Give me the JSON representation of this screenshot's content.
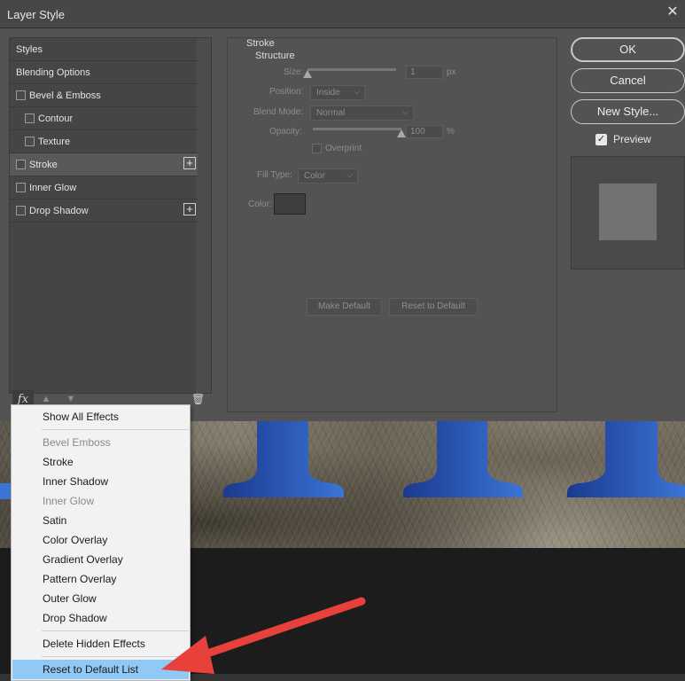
{
  "window": {
    "title": "Layer Style",
    "close_glyph": "✕"
  },
  "styles_list": [
    {
      "label": "Styles",
      "checkbox": false,
      "plus": false,
      "indent": 0,
      "selected": false
    },
    {
      "label": "Blending Options",
      "checkbox": false,
      "plus": false,
      "indent": 0,
      "selected": false
    },
    {
      "label": "Bevel & Emboss",
      "checkbox": true,
      "plus": false,
      "indent": 0,
      "selected": false
    },
    {
      "label": "Contour",
      "checkbox": true,
      "plus": false,
      "indent": 1,
      "selected": false
    },
    {
      "label": "Texture",
      "checkbox": true,
      "plus": false,
      "indent": 1,
      "selected": false
    },
    {
      "label": "Stroke",
      "checkbox": true,
      "plus": true,
      "indent": 0,
      "selected": true
    },
    {
      "label": "Inner Glow",
      "checkbox": true,
      "plus": false,
      "indent": 0,
      "selected": false
    },
    {
      "label": "Drop Shadow",
      "checkbox": true,
      "plus": true,
      "indent": 0,
      "selected": false
    }
  ],
  "plus_glyph": "+",
  "fx_bar": {
    "fx_label": "fx",
    "up_glyph": "▲",
    "down_glyph": "▼",
    "trash_glyph": "🗑"
  },
  "stroke_panel": {
    "title": "Stroke",
    "section": "Structure",
    "size_label": "Size:",
    "size_value": "1",
    "size_unit": "px",
    "size_slider_level": 0.0,
    "position_label": "Position:",
    "position_value": "Inside",
    "blend_mode_label": "Blend Mode:",
    "blend_mode_value": "Normal",
    "opacity_label": "Opacity:",
    "opacity_value": "100",
    "opacity_unit": "%",
    "opacity_slider_level": 1.0,
    "overprint_label": "Overprint",
    "fill_type_label": "Fill Type:",
    "fill_type_value": "Color",
    "color_label": "Color:",
    "make_default_label": "Make Default",
    "reset_default_label": "Reset to Default",
    "chevron_glyph": "⌵"
  },
  "right_buttons": {
    "ok_label": "OK",
    "cancel_label": "Cancel",
    "new_style_label": "New Style...",
    "preview_label": "Preview",
    "preview_checked": true,
    "check_glyph": "✓"
  },
  "fx_menu": {
    "items": [
      {
        "label": "Show All Effects",
        "disabled": false,
        "highlighted": false
      },
      {
        "label": "Bevel  Emboss",
        "disabled": true,
        "highlighted": false
      },
      {
        "label": "Stroke",
        "disabled": false,
        "highlighted": false
      },
      {
        "label": "Inner Shadow",
        "disabled": false,
        "highlighted": false
      },
      {
        "label": "Inner Glow",
        "disabled": true,
        "highlighted": false
      },
      {
        "label": "Satin",
        "disabled": false,
        "highlighted": false
      },
      {
        "label": "Color Overlay",
        "disabled": false,
        "highlighted": false
      },
      {
        "label": "Gradient Overlay",
        "disabled": false,
        "highlighted": false
      },
      {
        "label": "Pattern Overlay",
        "disabled": false,
        "highlighted": false
      },
      {
        "label": "Outer Glow",
        "disabled": false,
        "highlighted": false
      },
      {
        "label": "Drop Shadow",
        "disabled": false,
        "highlighted": false
      },
      {
        "label": "Delete Hidden Effects",
        "disabled": false,
        "highlighted": false
      },
      {
        "label": "Reset to Default List",
        "disabled": false,
        "highlighted": true
      }
    ]
  },
  "colors": {
    "dialog_bg": "#535353",
    "menu_highlight": "#90c8f6",
    "annotation_arrow": "#e8413c",
    "shape_blue_dark": "#1b3a8f",
    "shape_blue_light": "#3b74d6"
  }
}
